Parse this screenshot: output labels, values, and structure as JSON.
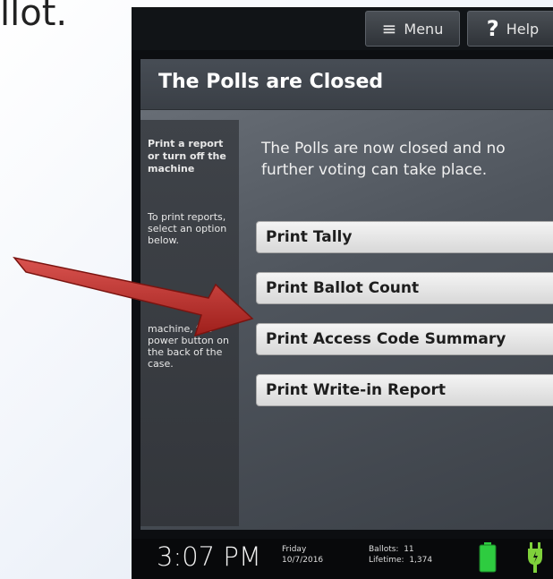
{
  "slide": {
    "text": "llot."
  },
  "topbar": {
    "menu_label": "Menu",
    "help_label": "Help",
    "menu_icon": "hamburger-icon",
    "help_icon": "question-icon"
  },
  "header": {
    "title": "The Polls are Closed"
  },
  "sidebar": {
    "title": "Print a report or turn off the machine",
    "instruction": "To print reports, select an option below.",
    "power": "machine, the power button on the back of the case."
  },
  "main": {
    "message": "The Polls are now closed and no further voting can take place.",
    "options": [
      {
        "label": "Print Tally"
      },
      {
        "label": "Print Ballot Count"
      },
      {
        "label": "Print Access Code Summary"
      },
      {
        "label": "Print Write-in Report"
      }
    ]
  },
  "status": {
    "time": "3:07 PM",
    "day": "Friday",
    "date": "10/7/2016",
    "ballots_label": "Ballots:",
    "ballots_value": "11",
    "lifetime_label": "Lifetime:",
    "lifetime_value": "1,374",
    "battery_color": "#2ecc40",
    "plug_color": "#7fd13b"
  },
  "arrow_color": "#c0392b"
}
